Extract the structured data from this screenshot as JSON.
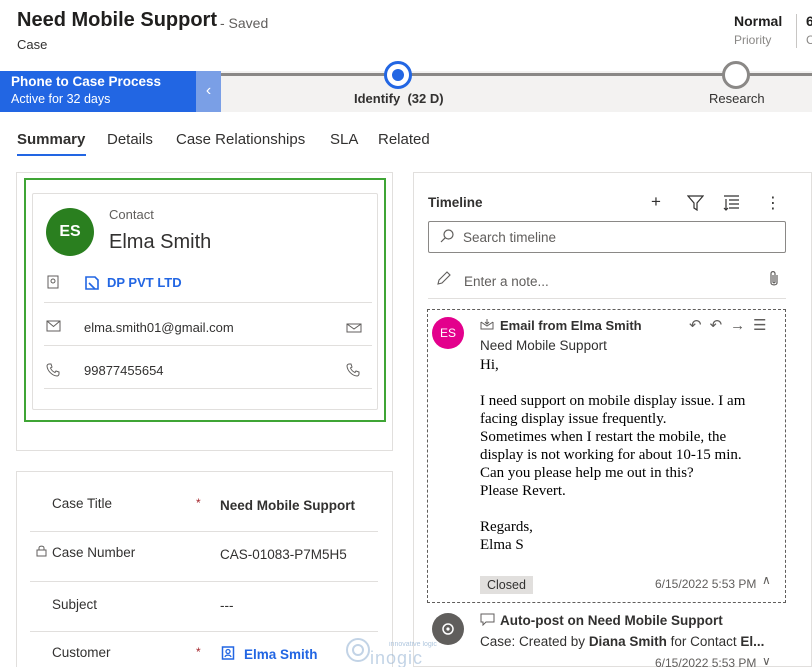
{
  "header": {
    "title": "Need Mobile Support",
    "saved_status": "- Saved",
    "entity": "Case",
    "priority_value": "Normal",
    "priority_label": "Priority",
    "extra_value": "6",
    "extra_label": "C"
  },
  "bpf": {
    "process_name": "Phone to Case Process",
    "active_for": "Active for 32 days",
    "stages": [
      {
        "label": "Identify  (32 D)",
        "active": true
      },
      {
        "label": "Research",
        "active": false
      }
    ]
  },
  "tabs": [
    "Summary",
    "Details",
    "Case Relationships",
    "SLA",
    "Related"
  ],
  "contact_card": {
    "initials": "ES",
    "label": "Contact",
    "name": "Elma Smith",
    "account": "DP PVT LTD",
    "email": "elma.smith01@gmail.com",
    "phone": "99877455654"
  },
  "form": {
    "fields": [
      {
        "label": "Case Title",
        "required": "*",
        "value": "Need Mobile Support"
      },
      {
        "label": "Case Number",
        "required": "",
        "value": "CAS-01083-P7M5H5"
      },
      {
        "label": "Subject",
        "required": "",
        "value": "---"
      },
      {
        "label": "Customer",
        "required": "*",
        "value": "Elma Smith"
      }
    ]
  },
  "timeline": {
    "title": "Timeline",
    "search_placeholder": "Search timeline",
    "note_placeholder": "Enter a note...",
    "items": [
      {
        "initials": "ES",
        "title": "Email from Elma Smith",
        "subtitle": "Need Mobile Support",
        "body": [
          "Hi,",
          "",
          "I need support on mobile display issue. I am",
          "facing display issue frequently.",
          "Sometimes when I restart the mobile, the",
          "display is not working for about 10-15 min.",
          "Can you please help me out in this?",
          "Please Revert.",
          "",
          "Regards,",
          "Elma S"
        ],
        "status": "Closed",
        "date": "6/15/2022 5:53 PM"
      },
      {
        "title": "Auto-post on Need Mobile Support",
        "line_prefix": "Case: Created by ",
        "line_user": "Diana Smith",
        "line_mid": " for Contact ",
        "line_contact": "El...",
        "date": "6/15/2022 5:53 PM"
      }
    ]
  },
  "watermark": {
    "tagline": "innovative logic",
    "brand": "inogic"
  },
  "colors": {
    "accent": "#2266e3",
    "highlight_border": "#3fa535",
    "avatar_green": "#2a7f1f",
    "avatar_pink": "#e3008c",
    "required": "#a4262c"
  }
}
